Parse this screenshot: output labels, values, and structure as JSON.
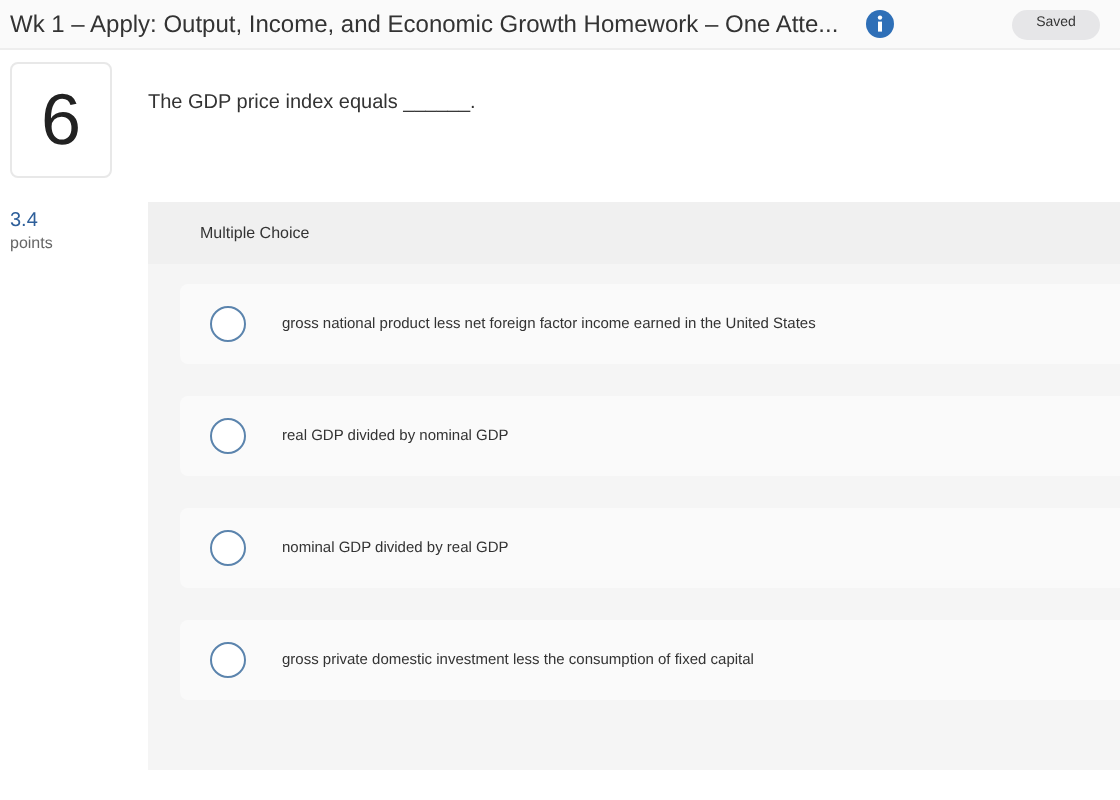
{
  "header": {
    "title": "Wk 1 – Apply: Output, Income, and Economic Growth Homework – One Atte...",
    "status": "Saved"
  },
  "question": {
    "number": "6",
    "text": "The GDP price index equals ______.",
    "points": "3.4",
    "points_label": "points"
  },
  "answer_panel": {
    "title": "Multiple Choice",
    "options": [
      {
        "text": "gross national product less net foreign factor income earned in the United States",
        "selected": false
      },
      {
        "text": "real GDP divided by nominal GDP",
        "selected": false
      },
      {
        "text": "nominal GDP divided by real GDP",
        "selected": false
      },
      {
        "text": "gross private domestic investment less the consumption of fixed capital",
        "selected": false
      }
    ]
  }
}
